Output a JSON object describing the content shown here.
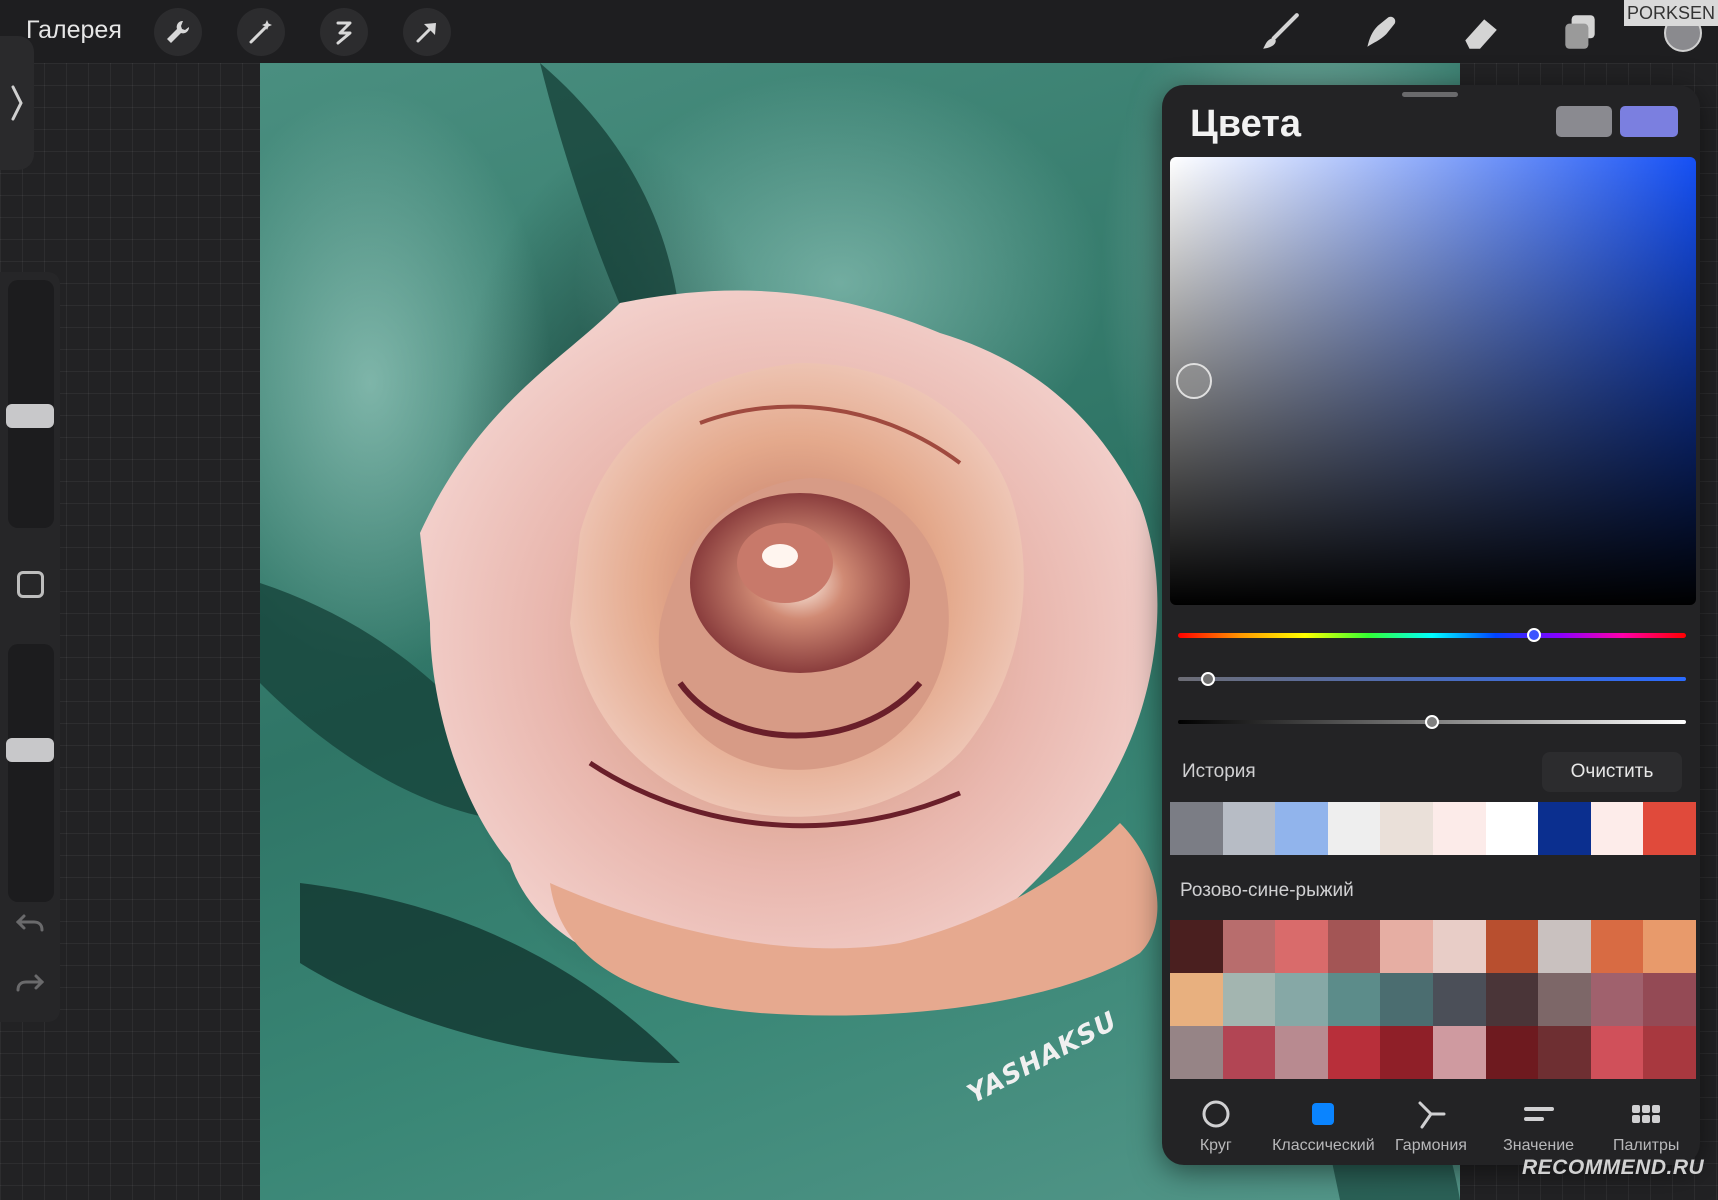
{
  "topbar": {
    "gallery_label": "Галерея",
    "tools_left": [
      "wrench-icon",
      "magic-wand-icon",
      "selection-icon",
      "transform-arrow-icon"
    ],
    "tools_right": [
      "brush-icon",
      "smudge-icon",
      "eraser-icon",
      "layers-icon"
    ],
    "current_color": "#8a8a8e"
  },
  "watermark_top": "PORKSEN",
  "artwork": {
    "signature": "YASHAKSU"
  },
  "colors_panel": {
    "title": "Цвета",
    "secondary_color": "#8a8a90",
    "primary_color": "#7b7fe0",
    "hue_level": 0.7,
    "saturation_level": 0.06,
    "brightness_level": 0.5,
    "history_label": "История",
    "clear_label": "Очистить",
    "history_colors": [
      "#7b7d85",
      "#b7bcc5",
      "#91b4ec",
      "#eeeeee",
      "#eae0d9",
      "#fcebe9",
      "#ffffff",
      "#0b2f8f",
      "#fdecea",
      "#e04a3b"
    ],
    "palette_name": "Розово-сине-рыжий",
    "palette_colors": [
      "#4a1f1f",
      "#b86d6d",
      "#d96b6b",
      "#a35555",
      "#e6aea3",
      "#e8cdc7",
      "#b84f2f",
      "#c9c1bf",
      "#d86b43",
      "#e89a6b",
      "#e8b07f",
      "#a3b5b0",
      "#86a8a6",
      "#5c8c8a",
      "#4b6d70",
      "#4b4f58",
      "#4a3538",
      "#7d6768",
      "#a0616d",
      "#944a55",
      "#968486",
      "#b24554",
      "#b88a90",
      "#b82f3a",
      "#8f1f28",
      "#cf9aa0",
      "#6e1a1f",
      "#6e2f32",
      "#d0505a",
      "#a8383f"
    ],
    "tabs": [
      {
        "label": "Круг",
        "icon": "circle-icon"
      },
      {
        "label": "Классический",
        "icon": "square-icon"
      },
      {
        "label": "Гармония",
        "icon": "harmony-icon"
      },
      {
        "label": "Значение",
        "icon": "value-sliders-icon"
      },
      {
        "label": "Палитры",
        "icon": "palettes-grid-icon"
      }
    ],
    "active_tab": "Классический",
    "accent_color": "#0a84ff"
  },
  "watermark_bottom": "RECOMMEND.RU"
}
